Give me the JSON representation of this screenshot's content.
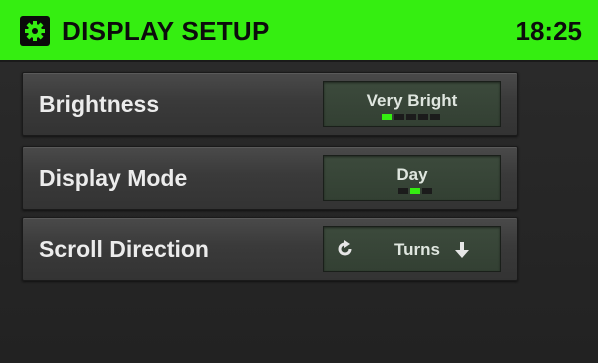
{
  "header": {
    "title": "DISPLAY SETUP",
    "time": "18:25",
    "icon": "gear-icon",
    "accent_color": "#35ee11"
  },
  "settings": [
    {
      "label": "Brightness",
      "value": "Very Bright",
      "level": {
        "selected": 1,
        "count": 5
      }
    },
    {
      "label": "Display Mode",
      "value": "Day",
      "level": {
        "selected": 2,
        "count": 3
      }
    },
    {
      "label": "Scroll Direction",
      "value": "Turns",
      "icons": [
        "rotate-icon",
        "arrow-down-icon"
      ]
    }
  ]
}
